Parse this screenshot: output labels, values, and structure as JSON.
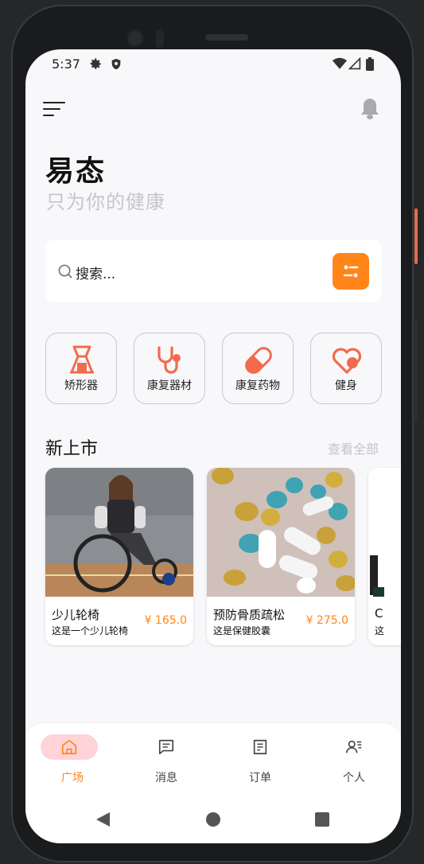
{
  "status_bar": {
    "time": "5:37"
  },
  "header": {
    "title": "易态",
    "subtitle": "只为你的健康"
  },
  "search": {
    "placeholder": "搜索..."
  },
  "categories": [
    {
      "label": "矫形器",
      "icon": "orthosis-icon"
    },
    {
      "label": "康复器材",
      "icon": "stethoscope-icon"
    },
    {
      "label": "康复药物",
      "icon": "pill-icon"
    },
    {
      "label": "健身",
      "icon": "heart-icon"
    }
  ],
  "section": {
    "title": "新上市",
    "link": "查看全部"
  },
  "products": [
    {
      "name": "少儿轮椅",
      "desc": "这是一个少儿轮椅",
      "price": "¥ 165.0"
    },
    {
      "name": "预防骨质疏松",
      "desc": "这是保健胶囊",
      "price": "¥ 275.0"
    },
    {
      "name": "C",
      "desc": "这",
      "price": ""
    }
  ],
  "bottom_nav": [
    {
      "label": "广场",
      "icon": "home-icon",
      "active": true
    },
    {
      "label": "消息",
      "icon": "message-icon",
      "active": false
    },
    {
      "label": "订单",
      "icon": "order-icon",
      "active": false
    },
    {
      "label": "个人",
      "icon": "profile-icon",
      "active": false
    }
  ],
  "colors": {
    "accent": "#ff8519",
    "active_nav_bg": "#ffd3d8",
    "icon_coral": "#f26b4d"
  }
}
